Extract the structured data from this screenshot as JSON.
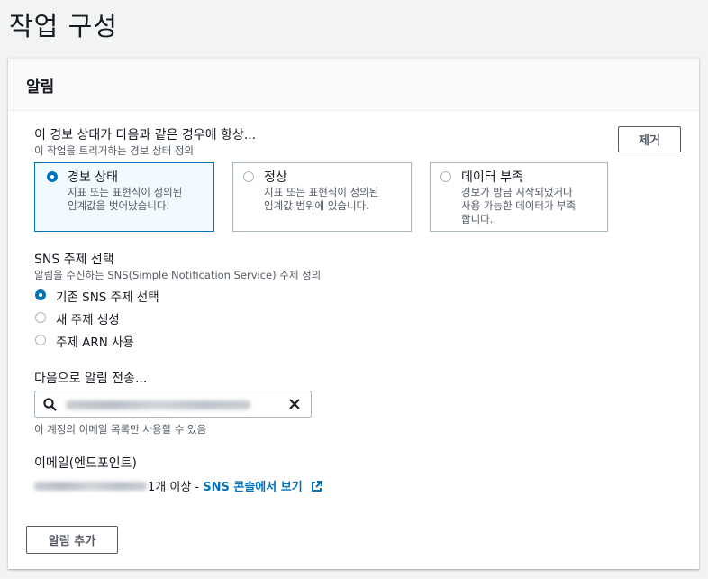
{
  "page": {
    "title": "작업 구성"
  },
  "panel": {
    "title": "알림",
    "remove_label": "제거",
    "add_label": "알림 추가"
  },
  "state_section": {
    "label": "이 경보 상태가 다음과 같은 경우에 항상...",
    "description": "이 작업을 트리거하는 경보 상태 정의",
    "tiles": [
      {
        "title": "경보 상태",
        "desc1": "지표 또는 표현식이 정의된",
        "desc2": "임계값을 벗어났습니다.",
        "desc3": "",
        "selected": true
      },
      {
        "title": "정상",
        "desc1": "지표 또는 표현식이 정의된",
        "desc2": "임계값 범위에 있습니다.",
        "desc3": "",
        "selected": false
      },
      {
        "title": "데이터 부족",
        "desc1": "경보가 방금 시작되었거나",
        "desc2": "사용 가능한 데이터가 부족",
        "desc3": "합니다.",
        "selected": false
      }
    ]
  },
  "sns_section": {
    "label": "SNS 주제 선택",
    "description": "알림을 수신하는 SNS(Simple Notification Service) 주제 정의",
    "options": [
      {
        "label": "기존 SNS 주제 선택",
        "selected": true
      },
      {
        "label": "새 주제 생성",
        "selected": false
      },
      {
        "label": "주제 ARN 사용",
        "selected": false
      }
    ]
  },
  "send_section": {
    "label": "다음으로 알림 전송...",
    "hint": "이 계정의 이메일 목록만 사용할 수 있음"
  },
  "email_section": {
    "label": "이메일(엔드포인트)",
    "suffix": "1개 이상 - ",
    "link_text": "SNS 콘솔에서 보기"
  },
  "colors": {
    "accent": "#0073bb",
    "border": "#aab7b8",
    "text": "#16191f",
    "muted": "#545b64"
  }
}
